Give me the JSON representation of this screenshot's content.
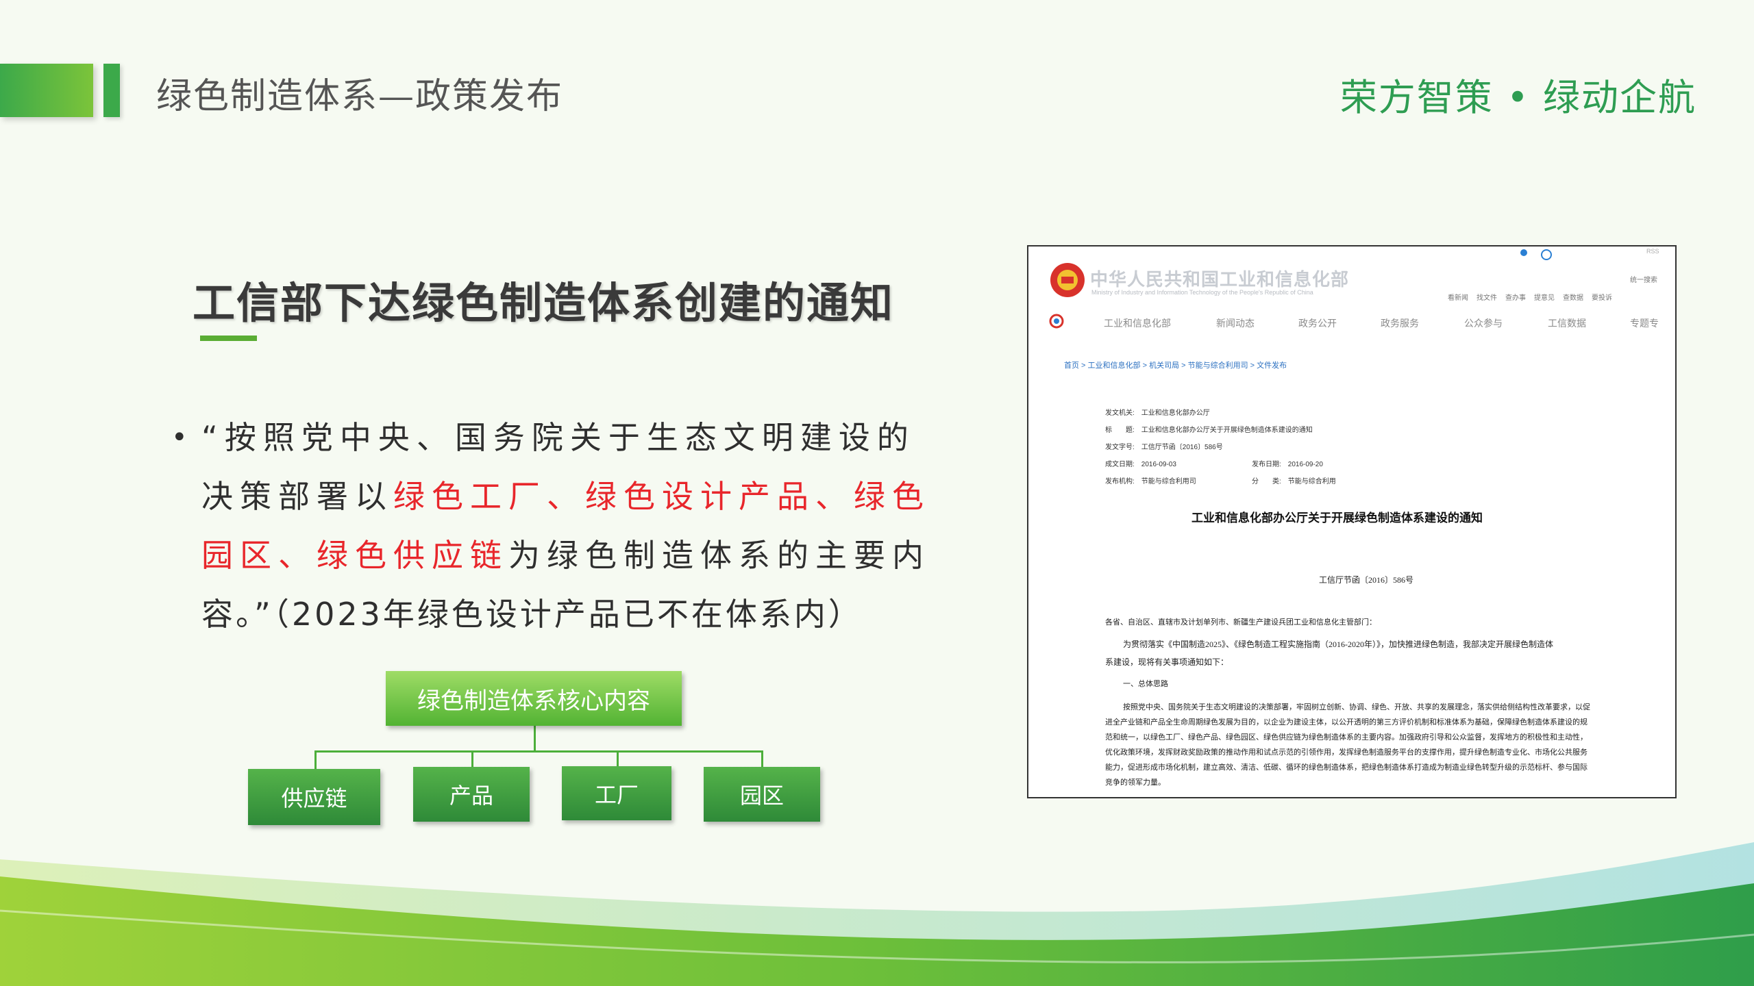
{
  "header": {
    "title": "绿色制造体系—政策发布",
    "brand": "荣方智策 • 绿动企航"
  },
  "main": {
    "heading": "工信部下达绿色制造体系创建的通知",
    "bullet": "•",
    "paragraph": {
      "line1": "“按照党中央、国务院关于生态文明建设的",
      "line2_a": "决策部署以",
      "line2_red": "绿色工厂、绿色设计产品、绿色",
      "line3_red": "园区、绿色供应链",
      "line3_b": "为绿色制造体系的主要内",
      "line4": "容。”（2023年绿色设计产品已不在体系内）"
    }
  },
  "org_chart": {
    "root": "绿色制造体系核心内容",
    "children": [
      "供应链",
      "产品",
      "工厂",
      "园区"
    ]
  },
  "doc": {
    "site_title": "中华人民共和国工业和信息化部",
    "site_subtitle": "Ministry of Industry and Information Technology of the People's Republic of China",
    "rss": "RSS",
    "search": "统一搜索",
    "top_links": [
      "看新闻",
      "找文件",
      "查办事",
      "提意见",
      "查数据",
      "要投诉"
    ],
    "nav": [
      "工业和信息化部",
      "新闻动态",
      "政务公开",
      "政务服务",
      "公众参与",
      "工信数据",
      "专题专"
    ],
    "breadcrumb": "首页 > 工业和信息化部 > 机关司局 > 节能与综合利用司 > 文件发布",
    "meta": {
      "issuer": "发文机关:　工业和信息化部办公厅",
      "title": "标　　题:　工业和信息化部办公厅关于开展绿色制造体系建设的通知",
      "doc_no": "发文字号:　工信厅节函〔2016〕586号",
      "date": "成文日期:　2016-09-03",
      "pub_date": "发布日期:　2016-09-20",
      "org": "发布机构:　节能与综合利用司",
      "category": "分　　类:　节能与综合利用"
    },
    "doc_title": "工业和信息化部办公厅关于开展绿色制造体系建设的通知",
    "doc_number": "工信厅节函〔2016〕586号",
    "address": "各省、自治区、直辖市及计划单列市、新疆生产建设兵团工业和信息化主管部门：",
    "intro1": "为贯彻落实《中国制造2025》、《绿色制造工程实施指南（2016-2020年）》，加快推进绿色制造，我部决定开展绿色制造体",
    "intro2": "系建设，现将有关事项通知如下：",
    "section1": "一、总体思路",
    "body": [
      "按照党中央、国务院关于生态文明建设的决策部署，牢固树立创新、协调、绿色、开放、共享的发展理念，落实供给侧结构性改革要求，以促",
      "进全产业链和产品全生命周期绿色发展为目的，以企业为建设主体，以公开透明的第三方评价机制和标准体系为基础，保障绿色制造体系建设的规",
      "范和统一，以绿色工厂、绿色产品、绿色园区、绿色供应链为绿色制造体系的主要内容。加强政府引导和公众监督，发挥地方的积极性和主动性，",
      "优化政策环境，发挥财政奖励政策的推动作用和试点示范的引领作用，发挥绿色制造服务平台的支撑作用，提升绿色制造专业化、市场化公共服务",
      "能力，促进形成市场化机制，建立高效、清洁、低碳、循环的绿色制造体系，把绿色制造体系打造成为制造业绿色转型升级的示范标杆、参与国际",
      "竞争的领军力量。"
    ]
  },
  "colors": {
    "accent_green": "#3ca94a",
    "brand_green": "#2e9d52",
    "highlight_red": "#e8262b"
  }
}
